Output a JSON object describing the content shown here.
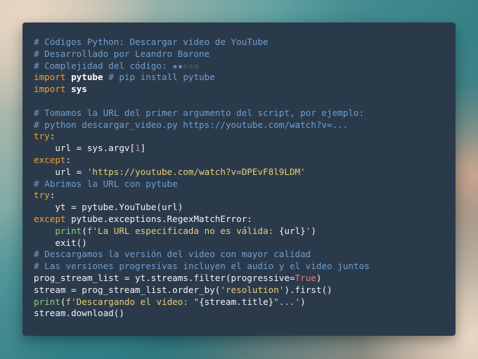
{
  "lines": [
    [
      {
        "c": "c",
        "t": "# Códigos Python: Descargar video de YouTube"
      }
    ],
    [
      {
        "c": "c",
        "t": "# Desarrollado por Leandro Barone"
      }
    ],
    [
      {
        "c": "c",
        "t": "# Complejidad del código: ★★☆☆☆"
      }
    ],
    [
      {
        "c": "k",
        "t": "import"
      },
      {
        "c": "t",
        "t": " "
      },
      {
        "c": "n",
        "t": "pytube"
      },
      {
        "c": "t",
        "t": " "
      },
      {
        "c": "c",
        "t": "# pip install pytube"
      }
    ],
    [
      {
        "c": "k",
        "t": "import"
      },
      {
        "c": "t",
        "t": " "
      },
      {
        "c": "n",
        "t": "sys"
      }
    ],
    [],
    [
      {
        "c": "c",
        "t": "# Tomamos la URL del primer argumento del script, por ejemplo:"
      }
    ],
    [
      {
        "c": "c",
        "t": "# python descargar_video.py https://youtube.com/watch?v=..."
      }
    ],
    [
      {
        "c": "k",
        "t": "try"
      },
      {
        "c": "t",
        "t": ":"
      }
    ],
    [
      {
        "c": "t",
        "t": "    url = sys.argv["
      },
      {
        "c": "num",
        "t": "1"
      },
      {
        "c": "t",
        "t": "]"
      }
    ],
    [
      {
        "c": "k",
        "t": "except"
      },
      {
        "c": "t",
        "t": ":"
      }
    ],
    [
      {
        "c": "t",
        "t": "    url = "
      },
      {
        "c": "s",
        "t": "'https://youtube.com/watch?v=DPEvF8l9LDM'"
      }
    ],
    [
      {
        "c": "c",
        "t": "# Abrimos la URL con pytube"
      }
    ],
    [
      {
        "c": "k",
        "t": "try"
      },
      {
        "c": "t",
        "t": ":"
      }
    ],
    [
      {
        "c": "t",
        "t": "    yt = pytube.YouTube(url)"
      }
    ],
    [
      {
        "c": "k",
        "t": "except"
      },
      {
        "c": "t",
        "t": " pytube.exceptions.RegexMatchError:"
      }
    ],
    [
      {
        "c": "t",
        "t": "    "
      },
      {
        "c": "bi",
        "t": "print"
      },
      {
        "c": "t",
        "t": "("
      },
      {
        "c": "s",
        "t": "f'La URL especificada no es válida: "
      },
      {
        "c": "b",
        "t": "{url}"
      },
      {
        "c": "s",
        "t": "'"
      },
      {
        "c": "t",
        "t": ")"
      }
    ],
    [
      {
        "c": "t",
        "t": "    exit()"
      }
    ],
    [
      {
        "c": "c",
        "t": "# Descargamos la versión del video con mayor calidad"
      }
    ],
    [
      {
        "c": "c",
        "t": "# Las versiones progresivas incluyen el audio y el video juntos"
      }
    ],
    [
      {
        "c": "t",
        "t": "prog_stream_list = yt.streams.filter(progressive="
      },
      {
        "c": "kw",
        "t": "True"
      },
      {
        "c": "t",
        "t": ")"
      }
    ],
    [
      {
        "c": "t",
        "t": "stream = prog_stream_list.order_by("
      },
      {
        "c": "s",
        "t": "'resolution'"
      },
      {
        "c": "t",
        "t": ").first()"
      }
    ],
    [
      {
        "c": "bi",
        "t": "print"
      },
      {
        "c": "t",
        "t": "("
      },
      {
        "c": "s",
        "t": "f'Descargando el video: \""
      },
      {
        "c": "b",
        "t": "{stream.title}"
      },
      {
        "c": "s",
        "t": "\"...'"
      },
      {
        "c": "t",
        "t": ")"
      }
    ],
    [
      {
        "c": "t",
        "t": "stream.download()"
      }
    ]
  ]
}
